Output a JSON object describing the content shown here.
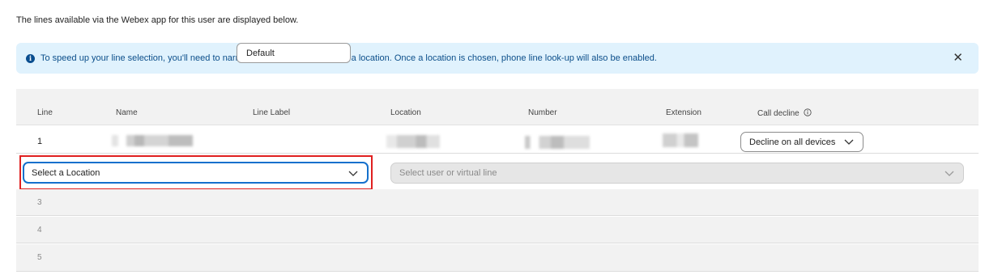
{
  "intro_text": "The lines available via the Webex app for this user are displayed below.",
  "banner": {
    "icon": "info-icon",
    "message": "To speed up your line selection, you'll need to narrow your search by choosing a location. Once a location is chosen, phone line look-up will also be enabled.",
    "close_icon": "close-icon"
  },
  "table": {
    "headers": [
      "Line",
      "Name",
      "Line Label",
      "Location",
      "Number",
      "Extension",
      "Call decline"
    ],
    "call_decline_info_icon": "info-circle-icon",
    "rows": [
      {
        "line": "1",
        "line_label_value": "Default",
        "call_decline_value": "Decline on all devices"
      }
    ],
    "editing_row": {
      "location_placeholder": "Select a Location",
      "user_placeholder": "Select user or virtual line"
    },
    "empty_rows": [
      "3",
      "4",
      "5"
    ]
  },
  "colors": {
    "banner_bg": "#e0f2fd",
    "banner_text": "#0b4e8a",
    "focus_blue": "#1470cc",
    "highlight_red": "#e02020"
  }
}
